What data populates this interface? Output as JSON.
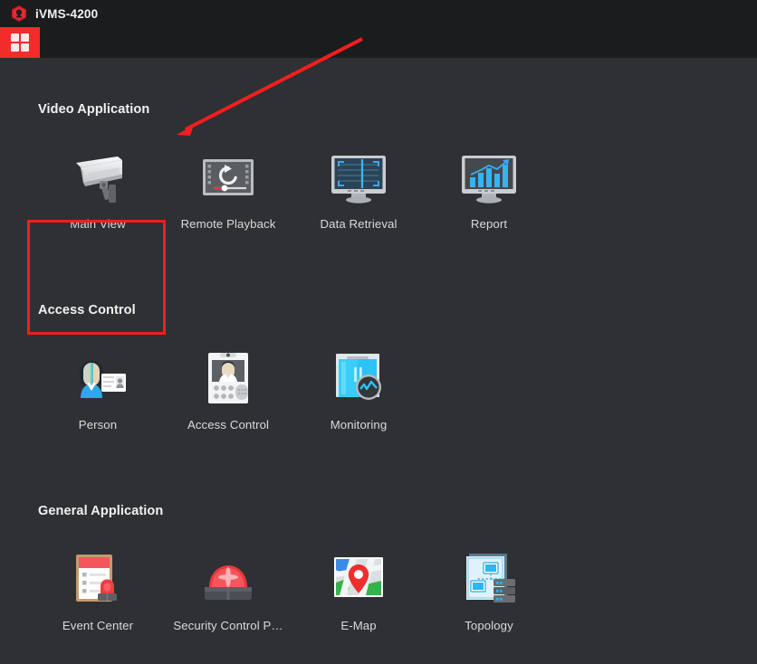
{
  "window": {
    "title": "iVMS-4200",
    "logo_icon": "hexagon-logo-icon",
    "logo_color": "#d5202a"
  },
  "tabbar": {
    "home_tab": {
      "name": "home-tab",
      "icon": "grid-2x2-icon",
      "active": true,
      "color": "#f22b2b"
    }
  },
  "annotation": {
    "highlight_target": "Main View",
    "highlight_color": "#f41e1e",
    "arrow_color": "#f41e1e",
    "arrow_from": "400,43",
    "arrow_to": "196,148"
  },
  "theme": {
    "background": "#2e3033",
    "titlebar_background": "#1b1c1e",
    "text_primary": "#f0f1f2",
    "text_secondary": "#d8dadc",
    "accent": "#f22b2b"
  },
  "sections": [
    {
      "title": "Video Application",
      "items": [
        {
          "label": "Main View",
          "icon": "cctv-camera-icon",
          "highlighted": true
        },
        {
          "label": "Remote Playback",
          "icon": "playback-replay-icon",
          "highlighted": false
        },
        {
          "label": "Data Retrieval",
          "icon": "monitor-search-icon",
          "highlighted": false
        },
        {
          "label": "Report",
          "icon": "monitor-chart-icon",
          "highlighted": false
        }
      ]
    },
    {
      "title": "Access Control",
      "items": [
        {
          "label": "Person",
          "icon": "person-id-card-icon",
          "highlighted": false
        },
        {
          "label": "Access Control",
          "icon": "access-terminal-icon",
          "highlighted": false
        },
        {
          "label": "Monitoring",
          "icon": "door-monitoring-icon",
          "highlighted": false
        }
      ]
    },
    {
      "title": "General Application",
      "items": [
        {
          "label": "Event Center",
          "icon": "clipboard-alarm-icon",
          "highlighted": false
        },
        {
          "label": "Security Control P…",
          "icon": "siren-beacon-icon",
          "highlighted": false
        },
        {
          "label": "E-Map",
          "icon": "map-pin-icon",
          "highlighted": false
        },
        {
          "label": "Topology",
          "icon": "network-topology-icon",
          "highlighted": false
        }
      ]
    }
  ]
}
